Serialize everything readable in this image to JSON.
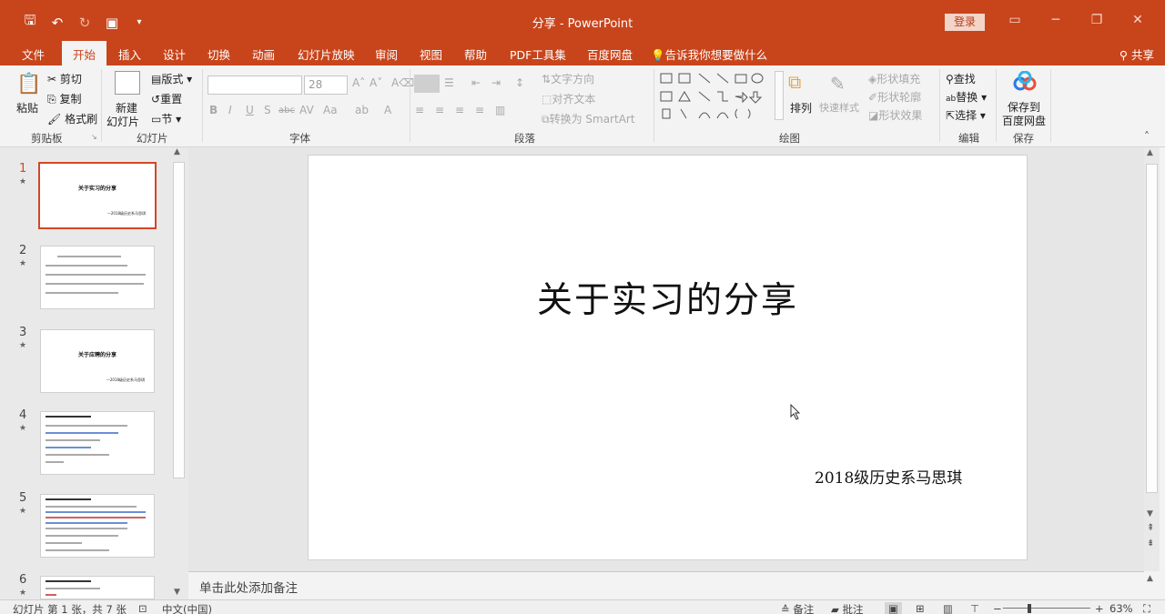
{
  "window": {
    "title": "分享 - PowerPoint",
    "login": "登录"
  },
  "tabs": [
    {
      "label": "文件"
    },
    {
      "label": "开始",
      "active": true
    },
    {
      "label": "插入"
    },
    {
      "label": "设计"
    },
    {
      "label": "切换"
    },
    {
      "label": "动画"
    },
    {
      "label": "幻灯片放映"
    },
    {
      "label": "审阅"
    },
    {
      "label": "视图"
    },
    {
      "label": "帮助"
    },
    {
      "label": "PDF工具集"
    },
    {
      "label": "百度网盘"
    }
  ],
  "tell_me": "告诉我你想要做什么",
  "share": "共享",
  "ribbon": {
    "clipboard": {
      "group": "剪贴板",
      "paste": "粘贴",
      "cut": "剪切",
      "copy": "复制",
      "format_painter": "格式刷"
    },
    "slides": {
      "group": "幻灯片",
      "new_slide_1": "新建",
      "new_slide_2": "幻灯片",
      "layout": "版式",
      "reset": "重置",
      "section": "节"
    },
    "font": {
      "group": "字体",
      "size": "28"
    },
    "paragraph": {
      "group": "段落",
      "text_direction": "文字方向",
      "align_text": "对齐文本",
      "smartart": "转换为 SmartArt"
    },
    "drawing": {
      "group": "绘图",
      "arrange": "排列",
      "quick_styles": "快速样式",
      "shape_fill": "形状填充",
      "shape_outline": "形状轮廓",
      "shape_effects": "形状效果"
    },
    "editing": {
      "group": "编辑",
      "find": "查找",
      "replace": "替换",
      "select": "选择"
    },
    "save": {
      "group": "保存",
      "btn_1": "保存到",
      "btn_2": "百度网盘"
    }
  },
  "thumbnails": [
    {
      "num": "1",
      "title": "关于实习的分享",
      "sub": "—2018级历史系马思琪",
      "selected": true
    },
    {
      "num": "2",
      "title": "",
      "sub": ""
    },
    {
      "num": "3",
      "title": "关于应聘的分享",
      "sub": "—2018级历史系马思琪"
    },
    {
      "num": "4",
      "title": "",
      "sub": ""
    },
    {
      "num": "5",
      "title": "",
      "sub": ""
    },
    {
      "num": "6",
      "title": "",
      "sub": ""
    }
  ],
  "slide": {
    "title": "关于实习的分享",
    "subtitle": "2018级历史系马思琪"
  },
  "notes_placeholder": "单击此处添加备注",
  "status": {
    "slide_info": "幻灯片 第 1 张，共 7 张",
    "language": "中文(中国)",
    "notes": "备注",
    "comments": "批注",
    "zoom": "63%"
  },
  "colors": {
    "accent": "#c8451c",
    "selection": "#d24726"
  }
}
